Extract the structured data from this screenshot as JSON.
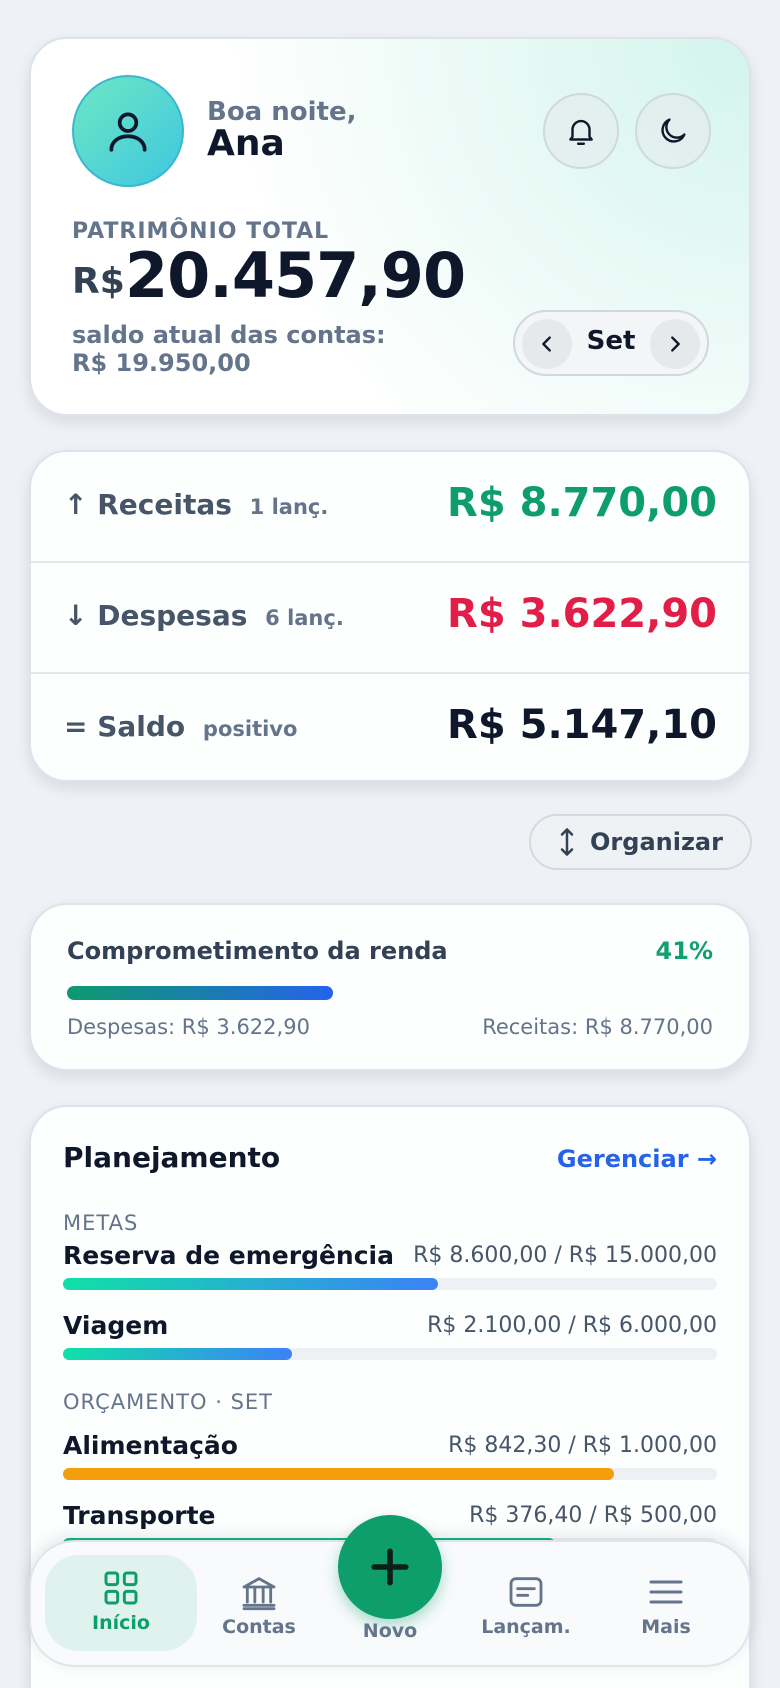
{
  "header": {
    "greeting": "Boa noite,",
    "user_name": "Ana",
    "icons": {
      "avatar": "user-icon",
      "notifications": "bell-icon",
      "theme": "moon-icon"
    },
    "total_label": "PATRIMÔNIO TOTAL",
    "total_currency": "R$",
    "total_value": "20.457,90",
    "balance_label": "saldo atual das contas:",
    "balance_value": "R$ 19.950,00",
    "month": "Set"
  },
  "summary": {
    "income": {
      "arrow": "↑",
      "label": "Receitas",
      "count": "1 lanç.",
      "amount": "R$ 8.770,00",
      "color": "#0e9e6c"
    },
    "expenses": {
      "arrow": "↓",
      "label": "Despesas",
      "count": "6 lanç.",
      "amount": "R$ 3.622,90",
      "color": "#e11d48"
    },
    "balance": {
      "arrow": "=",
      "label": "Saldo",
      "status": "positivo",
      "amount": "R$ 5.147,10",
      "color": "#0f172a"
    }
  },
  "organize_button": "Organizar",
  "commitment": {
    "title": "Comprometimento da renda",
    "percent_label": "41%",
    "percent": 0.41,
    "expenses_text": "Despesas: R$ 3.622,90",
    "income_text": "Receitas: R$ 8.770,00"
  },
  "planning": {
    "title": "Planejamento",
    "manage_link": "Gerenciar →",
    "goals_section": "METAS",
    "goals": [
      {
        "name": "Reserva de emergência",
        "value": "R$ 8.600,00 / R$ 15.000,00",
        "progress": 0.573
      },
      {
        "name": "Viagem",
        "value": "R$ 2.100,00 / R$ 6.000,00",
        "progress": 0.35
      }
    ],
    "budget_section": "ORÇAMENTO · SET",
    "budgets": [
      {
        "name": "Alimentação",
        "value": "R$ 842,30 / R$ 1.000,00",
        "progress": 0.842,
        "color": "#f59e0b"
      },
      {
        "name": "Transporte",
        "value": "R$ 376,40 / R$ 500,00",
        "progress": 0.753,
        "color": "#10b981"
      }
    ]
  },
  "nav": {
    "items": [
      {
        "label": "Início",
        "icon": "grid-icon",
        "active": true
      },
      {
        "label": "Contas",
        "icon": "bank-icon",
        "active": false
      },
      {
        "label": "Novo",
        "icon": "plus-icon",
        "active": false
      },
      {
        "label": "Lançam.",
        "icon": "receipt-icon",
        "active": false
      },
      {
        "label": "Mais",
        "icon": "menu-icon",
        "active": false
      }
    ],
    "accent": "#0e9e6c"
  }
}
